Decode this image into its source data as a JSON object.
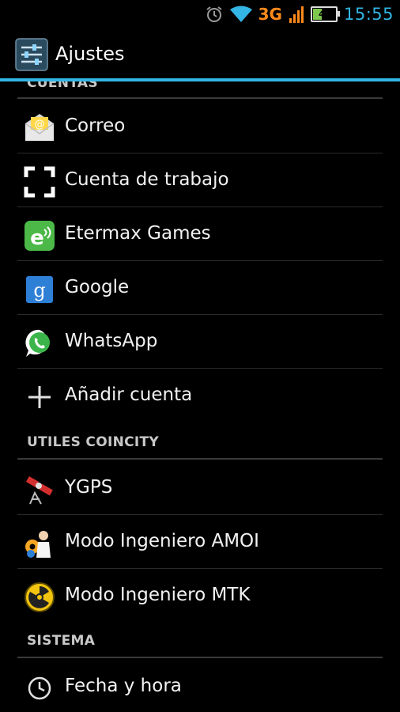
{
  "status_bar": {
    "time": "15:55",
    "network": "3G",
    "battery_level": "41",
    "battery_fraction": 0.41,
    "icons": [
      "alarm-icon",
      "wifi-icon",
      "signal-icon",
      "battery-icon"
    ]
  },
  "action_bar": {
    "title": "Ajustes",
    "icon": "settings-sliders-icon",
    "accent_color": "#33b5e5"
  },
  "sections": {
    "cuentas": {
      "header": "CUENTAS",
      "items": [
        {
          "label": "Correo",
          "icon": "email-icon"
        },
        {
          "label": "Cuenta de trabajo",
          "icon": "work-account-icon"
        },
        {
          "label": "Etermax Games",
          "icon": "etermax-icon"
        },
        {
          "label": "Google",
          "icon": "google-icon"
        },
        {
          "label": "WhatsApp",
          "icon": "whatsapp-icon"
        },
        {
          "label": "Añadir cuenta",
          "icon": "plus-icon"
        }
      ]
    },
    "utiles": {
      "header": "UTILES COINCITY",
      "items": [
        {
          "label": "YGPS",
          "icon": "satellite-icon"
        },
        {
          "label": "Modo Ingeniero AMOI",
          "icon": "engineer-gears-icon"
        },
        {
          "label": "Modo Ingeniero MTK",
          "icon": "radiation-icon"
        }
      ]
    },
    "sistema": {
      "header": "SISTEMA",
      "items": [
        {
          "label": "Fecha y hora",
          "icon": "clock-icon"
        }
      ]
    }
  }
}
